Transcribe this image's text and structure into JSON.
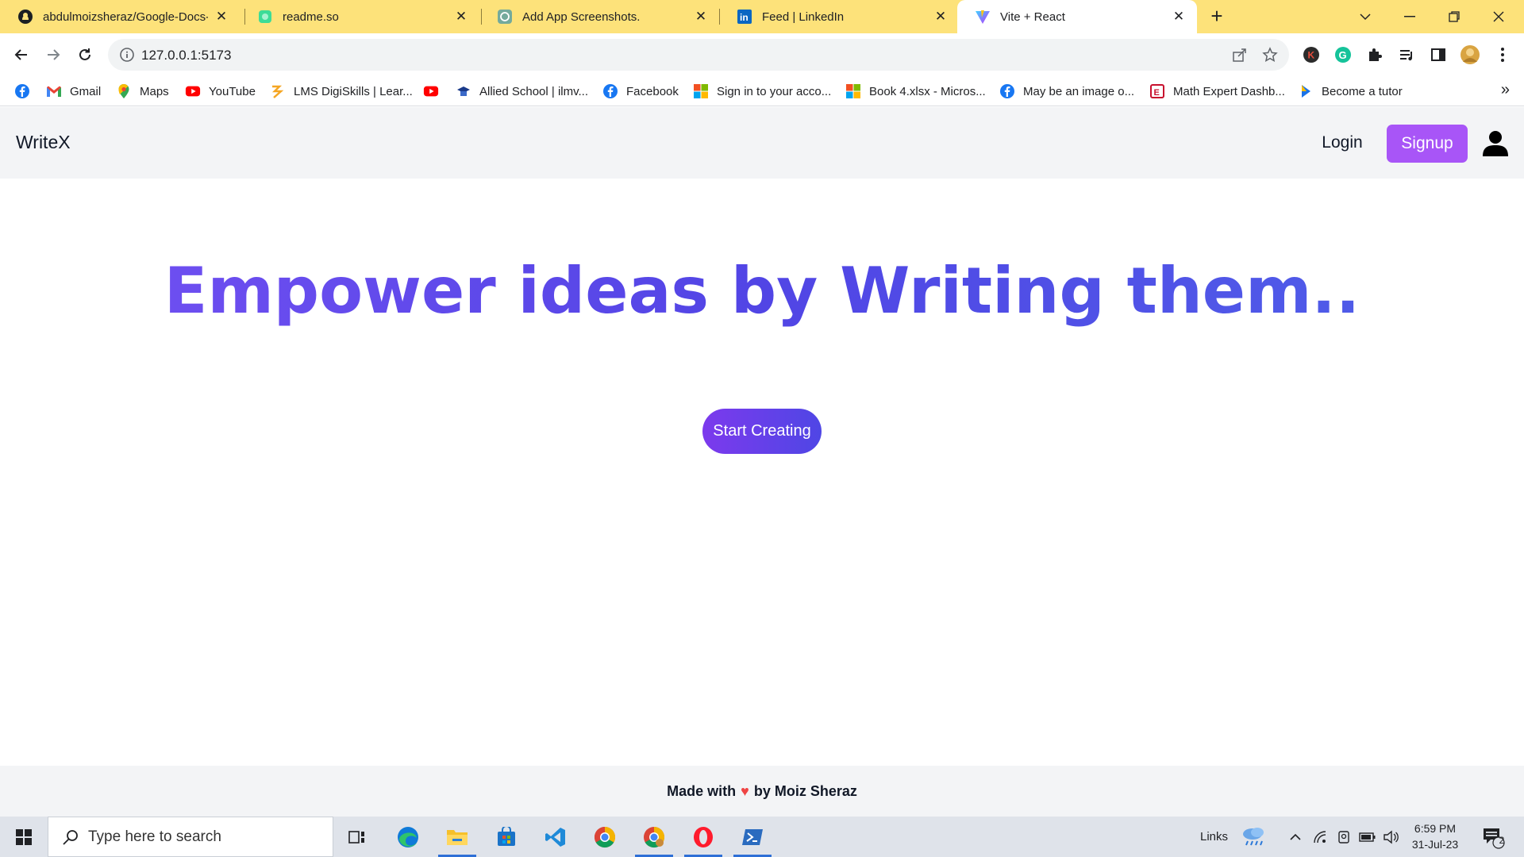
{
  "browser": {
    "tabs": [
      {
        "title": "abdulmoizsheraz/Google-Docs-C",
        "icon": "github-icon"
      },
      {
        "title": "readme.so",
        "icon": "readme-icon"
      },
      {
        "title": "Add App Screenshots.",
        "icon": "openai-icon"
      },
      {
        "title": "Feed | LinkedIn",
        "icon": "linkedin-icon"
      },
      {
        "title": "Vite + React",
        "icon": "vite-icon",
        "active": true
      }
    ],
    "url": "127.0.0.1:5173",
    "bookmarks": [
      {
        "label": "",
        "icon": "facebook-icon"
      },
      {
        "label": "Gmail",
        "icon": "gmail-icon"
      },
      {
        "label": "Maps",
        "icon": "maps-icon"
      },
      {
        "label": "YouTube",
        "icon": "youtube-icon"
      },
      {
        "label": "LMS DigiSkills | Lear...",
        "icon": "digiskills-icon"
      },
      {
        "label": "",
        "icon": "youtube-icon"
      },
      {
        "label": "Allied School | ilmv...",
        "icon": "school-icon"
      },
      {
        "label": "Facebook",
        "icon": "facebook-icon"
      },
      {
        "label": "Sign in to your acco...",
        "icon": "microsoft-icon"
      },
      {
        "label": "Book 4.xlsx - Micros...",
        "icon": "microsoft-icon"
      },
      {
        "label": "May be an image o...",
        "icon": "facebook-icon"
      },
      {
        "label": "Math Expert Dashb...",
        "icon": "math-expert-icon"
      },
      {
        "label": "Become a tutor",
        "icon": "tutor-icon"
      }
    ],
    "bookmarks_more": "»"
  },
  "app": {
    "brand": "WriteX",
    "login_label": "Login",
    "signup_label": "Signup",
    "hero_title": "Empower ideas by Writing them..",
    "cta_label": "Start Creating",
    "footer": {
      "prefix": "Made with",
      "heart": "♥",
      "suffix": "by Moiz Sheraz"
    },
    "colors": {
      "accent": "#a855f7",
      "hero": "#4f46e5",
      "heart": "#ef4444"
    }
  },
  "taskbar": {
    "search_placeholder": "Type here to search",
    "links_label": "Links",
    "time": "6:59 PM",
    "date": "31-Jul-23",
    "notification_count": "2"
  }
}
